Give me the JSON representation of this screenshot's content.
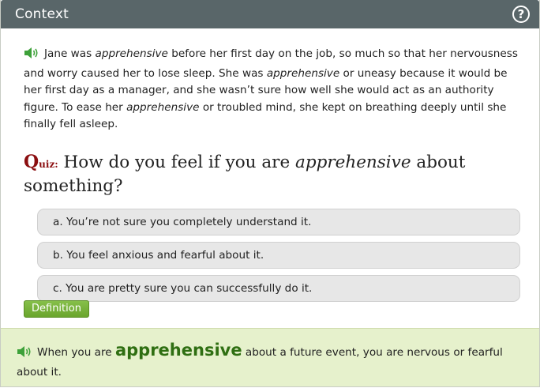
{
  "header": {
    "title": "Context",
    "help_symbol": "?"
  },
  "context": {
    "p1": "Jane was ",
    "word1": "apprehensive",
    "p2": " before her first day on the job, so much so that her nervousness and worry caused her to lose sleep. She was ",
    "word2": "apprehensive",
    "p3": " or uneasy because it would be her first day as a manager, and she wasn’t sure how well she would act as an authority figure. To ease her ",
    "word3": "apprehensive",
    "p4": " or troubled mind, she kept on breathing deeply until she finally fell asleep."
  },
  "quiz": {
    "label_q": "Q",
    "label_rest": "uiz:",
    "prefix": "How do you feel if you are ",
    "word": "apprehensive",
    "suffix": " about something?"
  },
  "options": [
    "a. You’re not sure you completely understand it.",
    "b. You feel anxious and fearful about it.",
    "c. You are pretty sure you can successfully do it."
  ],
  "definition_button": "Definition",
  "definition": {
    "prefix": "When you are ",
    "word": "apprehensive",
    "suffix": " about a future event, you are nervous or fearful about it."
  },
  "colors": {
    "header_bg": "#596669",
    "quiz_label": "#8b0e10",
    "definition_bg": "#e6f1cc",
    "button_green": "#6aa52d",
    "speaker_green": "#3ea13a"
  },
  "icons": [
    "help-icon",
    "speaker-icon"
  ]
}
